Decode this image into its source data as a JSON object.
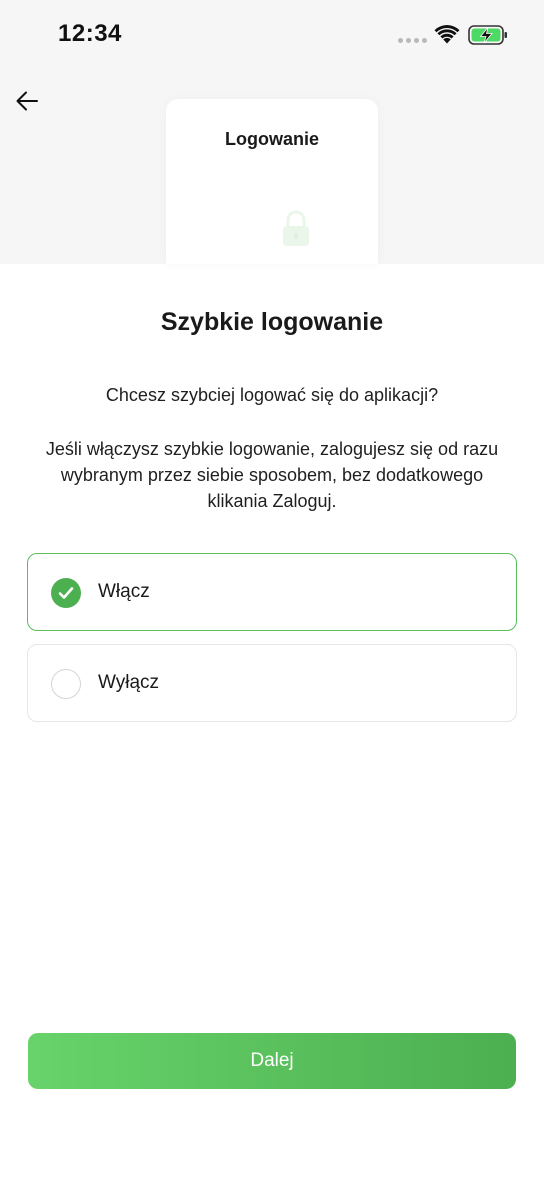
{
  "status_bar": {
    "time": "12:34",
    "signal_icon": "signal-dots-icon",
    "wifi_icon": "wifi-icon",
    "battery_icon": "battery-charging-icon"
  },
  "header": {
    "back_icon": "arrow-left-icon",
    "card_title": "Logowanie",
    "card_icon": "lock-icon"
  },
  "main": {
    "title": "Szybkie logowanie",
    "question": "Chcesz szybciej logować się do aplikacji?",
    "description": "Jeśli włączysz szybkie logowanie, zalogujesz się od razu wybranym przez siebie sposobem, bez dodatkowego klikania Zaloguj."
  },
  "options": [
    {
      "label": "Włącz",
      "selected": true
    },
    {
      "label": "Wyłącz",
      "selected": false
    }
  ],
  "actions": {
    "next_label": "Dalej"
  },
  "colors": {
    "accent": "#4caf50",
    "accent_light": "#68d36a",
    "header_bg": "#f6f6f6"
  }
}
